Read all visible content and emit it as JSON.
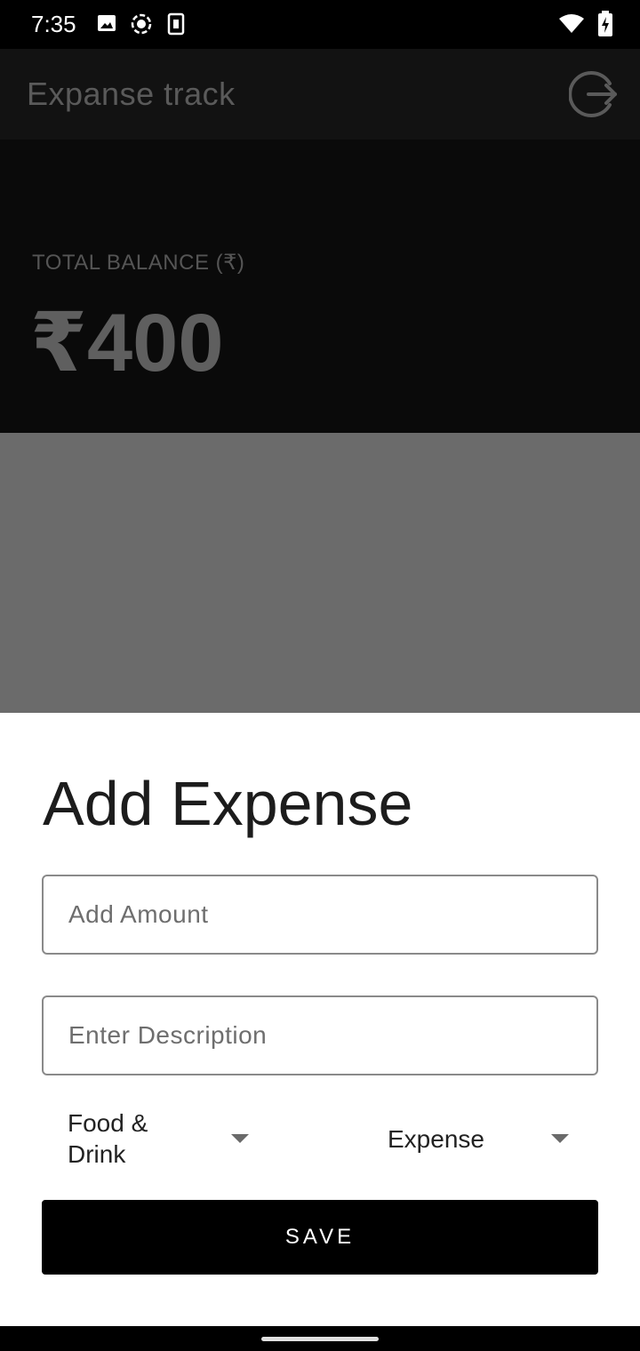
{
  "status_bar": {
    "time": "7:35",
    "left_icons": [
      "image-icon",
      "screen-record-icon",
      "sim-icon"
    ],
    "right_icons": [
      "wifi-icon",
      "battery-charging-icon"
    ]
  },
  "app_bar": {
    "title": "Expanse track",
    "logout_icon": "logout-icon"
  },
  "balance": {
    "label": "TOTAL BALANCE (₹)",
    "amount": "₹400"
  },
  "sheet": {
    "title": "Add Expense",
    "amount_placeholder": "Add Amount",
    "description_placeholder": "Enter Description",
    "category_selected": "Food & Drink",
    "type_selected": "Expense",
    "save_label": "SAVE"
  },
  "colors": {
    "sheet_background": "#ffffff",
    "scrim": "#6b6b6b",
    "button_background": "#000000",
    "button_text": "#ffffff"
  }
}
